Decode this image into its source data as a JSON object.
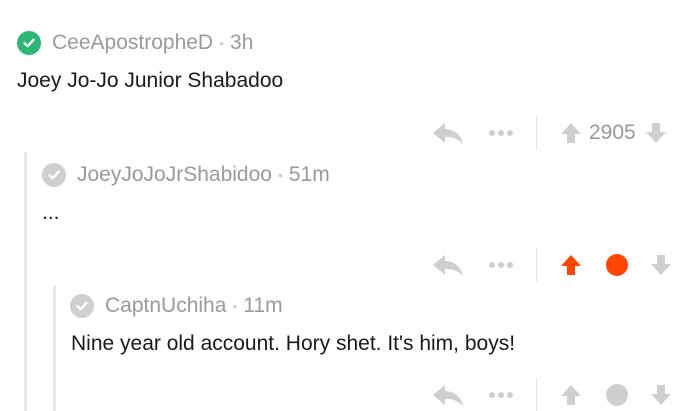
{
  "colors": {
    "verified_green": "#2bb673",
    "muted_gray": "#9a9a9a",
    "upvote_active": "#ff4500",
    "icon_gray": "#cfcfcf",
    "thread_line": "#e8e8e8"
  },
  "comments": [
    {
      "username": "CeeApostropheD",
      "age": "3h",
      "body": "Joey Jo-Jo Junior Shabadoo",
      "score": "2905",
      "badge": "verified-check-icon",
      "vote_state": "none"
    },
    {
      "username": "JoeyJoJoJrShabidoo",
      "age": "51m",
      "body": "...",
      "score": "",
      "badge": "gray-check-icon",
      "vote_state": "upvoted"
    },
    {
      "username": "CaptnUchiha",
      "age": "11m",
      "body": "Nine year old account. Hory shet. It's him, boys!",
      "score": "",
      "badge": "gray-check-icon",
      "vote_state": "none"
    }
  ],
  "separator": "•"
}
